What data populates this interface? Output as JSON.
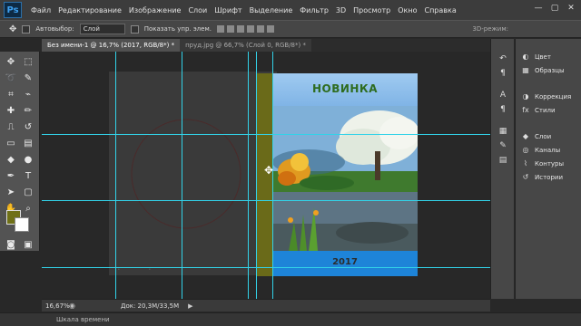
{
  "app": {
    "logo": "Ps"
  },
  "menu": [
    "Файл",
    "Редактирование",
    "Изображение",
    "Слои",
    "Шрифт",
    "Выделение",
    "Фильтр",
    "3D",
    "Просмотр",
    "Окно",
    "Справка"
  ],
  "window_controls": [
    "—",
    "▢",
    "✕"
  ],
  "options": {
    "autoselect_label": "Автовыбор:",
    "autoselect_value": "Слой",
    "show_controls_label": "Показать упр. элем.",
    "mode_3d": "3D-режим:"
  },
  "tabs": [
    {
      "label": "Без имени-1 @ 16,7% (2017, RGB/8*) *",
      "active": true
    },
    {
      "label": "пруд.jpg @ 66,7% (Слой 0, RGB/8*) *",
      "active": false
    }
  ],
  "tools": [
    {
      "icon": "move-icon",
      "glyph": "✥"
    },
    {
      "icon": "marquee-icon",
      "glyph": "⬚"
    },
    {
      "icon": "lasso-icon",
      "glyph": "➰"
    },
    {
      "icon": "quick-select-icon",
      "glyph": "✎"
    },
    {
      "icon": "crop-icon",
      "glyph": "⌗"
    },
    {
      "icon": "eyedropper-icon",
      "glyph": "⌁"
    },
    {
      "icon": "healing-brush-icon",
      "glyph": "✚"
    },
    {
      "icon": "brush-icon",
      "glyph": "✏"
    },
    {
      "icon": "clone-stamp-icon",
      "glyph": "⎍"
    },
    {
      "icon": "history-brush-icon",
      "glyph": "↺"
    },
    {
      "icon": "eraser-icon",
      "glyph": "▭"
    },
    {
      "icon": "gradient-icon",
      "glyph": "▤"
    },
    {
      "icon": "blur-icon",
      "glyph": "◆"
    },
    {
      "icon": "dodge-icon",
      "glyph": "●"
    },
    {
      "icon": "pen-icon",
      "glyph": "✒"
    },
    {
      "icon": "type-icon",
      "glyph": "T"
    },
    {
      "icon": "path-select-icon",
      "glyph": "➤"
    },
    {
      "icon": "shape-icon",
      "glyph": "▢"
    },
    {
      "icon": "hand-icon",
      "glyph": "✋"
    },
    {
      "icon": "zoom-icon",
      "glyph": "⌕"
    },
    {
      "icon": "quick-mask-icon",
      "glyph": "◙"
    },
    {
      "icon": "screen-mode-icon",
      "glyph": "▣"
    }
  ],
  "colors": {
    "foreground": "#6f7017",
    "background": "#ffffff",
    "guide": "#32d2e8",
    "cover_blue": "#1e84d8"
  },
  "cover": {
    "title": "НОВИНКА",
    "year": "2017"
  },
  "mini_tags": [
    "•",
    "•"
  ],
  "right_icons": [
    {
      "icon": "history-icon",
      "glyph": "↶"
    },
    {
      "icon": "adjust-icon",
      "glyph": "¶"
    },
    {
      "icon": "character-icon",
      "glyph": "A"
    },
    {
      "icon": "paragraph-icon",
      "glyph": "¶"
    },
    {
      "icon": "swatch-icon",
      "glyph": "▦"
    },
    {
      "icon": "brush-panel-icon",
      "glyph": "✎"
    },
    {
      "icon": "layer-comps-icon",
      "glyph": "▤"
    }
  ],
  "panels": {
    "group1": [
      {
        "icon": "color-icon",
        "glyph": "◐",
        "label": "Цвет"
      },
      {
        "icon": "swatches-icon",
        "glyph": "▦",
        "label": "Образцы"
      }
    ],
    "group2": [
      {
        "icon": "correction-icon",
        "glyph": "◑",
        "label": "Коррекция"
      },
      {
        "icon": "styles-icon",
        "glyph": "fx",
        "label": "Стили"
      }
    ],
    "group3": [
      {
        "icon": "layers-icon",
        "glyph": "◆",
        "label": "Слои"
      },
      {
        "icon": "channels-icon",
        "glyph": "◎",
        "label": "Каналы"
      },
      {
        "icon": "paths-icon",
        "glyph": "⌇",
        "label": "Контуры"
      },
      {
        "icon": "history-panel-icon",
        "glyph": "↺",
        "label": "Истории"
      }
    ]
  },
  "status": {
    "zoom": "16,67%",
    "doc_info": "Док: 20,3M/33,5M",
    "arrow": "▶"
  },
  "timeline": {
    "label": "Шкала времени"
  }
}
